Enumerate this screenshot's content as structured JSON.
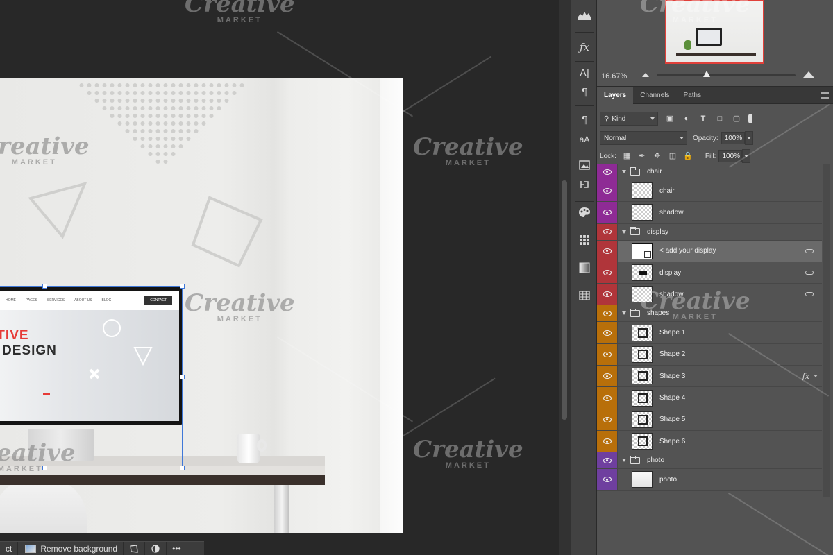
{
  "canvas": {
    "site_nav": [
      "HOME",
      "PAGES",
      "SERVICES",
      "ABOUT US",
      "BLOG"
    ],
    "site_contact": "CONTACT",
    "hero_line1": "ATIVE",
    "hero_line2": "B DESIGN"
  },
  "context_bar": {
    "left_fragment": "ct",
    "remove_background": "Remove background",
    "more": "•••"
  },
  "watermark": {
    "title": "Creative",
    "sub": "MARKET"
  },
  "navigator": {
    "zoom": "16.67%",
    "zoom_level": 0.36
  },
  "tabs": [
    "Layers",
    "Channels",
    "Paths"
  ],
  "controls": {
    "kind": "Kind",
    "blend_mode": "Normal",
    "opacity_label": "Opacity:",
    "opacity_value": "100%",
    "lock_label": "Lock:",
    "fill_label": "Fill:",
    "fill_value": "100%"
  },
  "layers": [
    {
      "name": "chair",
      "type": "group",
      "color": "#8e2b95"
    },
    {
      "name": "chair",
      "type": "layer",
      "color": "#8e2b95"
    },
    {
      "name": "shadow",
      "type": "layer",
      "color": "#8e2b95"
    },
    {
      "name": "display",
      "type": "group",
      "color": "#b0353a"
    },
    {
      "name": "< add your display",
      "type": "smart",
      "color": "#b0353a",
      "selected": true,
      "linked": true
    },
    {
      "name": "display",
      "type": "layer",
      "color": "#b0353a",
      "linked": true
    },
    {
      "name": "shadow",
      "type": "layer",
      "color": "#b0353a",
      "linked": true
    },
    {
      "name": "shapes",
      "type": "group",
      "color": "#b86f0a"
    },
    {
      "name": "Shape 1",
      "type": "shape",
      "color": "#b86f0a"
    },
    {
      "name": "Shape 2",
      "type": "shape",
      "color": "#b86f0a"
    },
    {
      "name": "Shape 3",
      "type": "shape",
      "color": "#b86f0a",
      "fx": "fx"
    },
    {
      "name": "Shape 4",
      "type": "shape",
      "color": "#b86f0a"
    },
    {
      "name": "Shape 5",
      "type": "shape",
      "color": "#b86f0a"
    },
    {
      "name": "Shape 6",
      "type": "shape",
      "color": "#b86f0a"
    },
    {
      "name": "photo",
      "type": "group",
      "color": "#6f3f9f"
    },
    {
      "name": "photo",
      "type": "photo",
      "color": "#6f3f9f"
    }
  ],
  "colors": {
    "guide": "#2fd3e0",
    "selection": "#3f78d8",
    "nav_frame": "#e0403a"
  },
  "icons": [
    "histogram-icon",
    "fx-icon",
    "character-icon",
    "paragraph-icon",
    "paragraph-styles-icon",
    "glyphs-icon",
    "libraries-icon",
    "history-icon",
    "swatches-icon",
    "patterns-icon",
    "gradients-icon",
    "table-icon"
  ]
}
